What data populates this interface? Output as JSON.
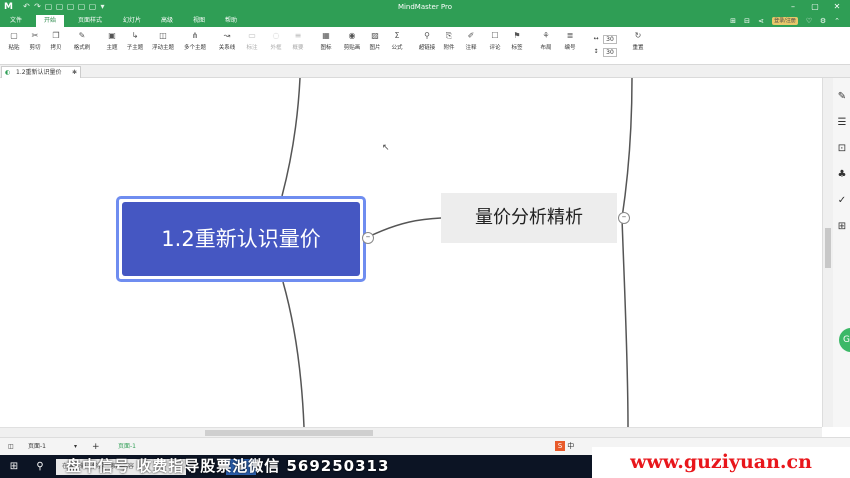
{
  "titlebar": {
    "title": "MindMaster Pro",
    "logo": "M",
    "quick_access": [
      "↶",
      "↷",
      "▢",
      "▢",
      "▢",
      "▢",
      "▢",
      "▾"
    ],
    "window_buttons": [
      "–",
      "▢",
      "✕"
    ]
  },
  "menubar": {
    "tabs": [
      "文件",
      "开始",
      "页面样式",
      "幻灯片",
      "高级",
      "视图",
      "帮助"
    ],
    "active_tab": "开始",
    "user": "登录/注册"
  },
  "ribbon": {
    "tools": [
      {
        "icon": "▢",
        "label": "粘贴"
      },
      {
        "icon": "✂",
        "label": "剪切"
      },
      {
        "icon": "❐",
        "label": "拷贝"
      },
      {
        "icon": "✎",
        "label": "格式刷"
      },
      {
        "icon": "▣",
        "label": "主题"
      },
      {
        "icon": "↳",
        "label": "子主题"
      },
      {
        "icon": "◫",
        "label": "浮动主题"
      },
      {
        "icon": "⋔",
        "label": "多个主题"
      },
      {
        "icon": "↝",
        "label": "关系线"
      },
      {
        "icon": "▭",
        "label": "标注"
      },
      {
        "icon": "◌",
        "label": "外框"
      },
      {
        "icon": "≡",
        "label": "概要"
      },
      {
        "icon": "▦",
        "label": "图标"
      },
      {
        "icon": "◉",
        "label": "剪贴画"
      },
      {
        "icon": "▨",
        "label": "图片"
      },
      {
        "icon": "Σ",
        "label": "公式"
      },
      {
        "icon": "⚲",
        "label": "超链接"
      },
      {
        "icon": "⎘",
        "label": "附件"
      },
      {
        "icon": "✐",
        "label": "注释"
      },
      {
        "icon": "☐",
        "label": "评论"
      },
      {
        "icon": "⚑",
        "label": "标签"
      },
      {
        "icon": "⚘",
        "label": "布局"
      },
      {
        "icon": "≣",
        "label": "编号"
      },
      {
        "icon": "↻",
        "label": "重置"
      }
    ],
    "size_w": "30",
    "size_h": "30"
  },
  "doc_tab": {
    "label": "1.2重新认识量价",
    "close": "✱"
  },
  "canvas": {
    "main_topic": "1.2重新认识量价",
    "sub_topic": "量价分析精析",
    "collapse_symbol": "–",
    "cursor": "↖"
  },
  "right_panel": {
    "icons": [
      "✎",
      "☰",
      "⊡",
      "♣",
      "✓",
      "⊞"
    ],
    "bubble": "G"
  },
  "pagebar": {
    "page_selector": "页面-1",
    "add": "+",
    "active_page": "页面-1",
    "ime": "中"
  },
  "taskbar": {
    "start": "⊞",
    "search_icon": "⚲",
    "search_text": "在这里输入你要搜索的内容"
  },
  "watermarks": {
    "left": "盘中信号 收费指导股票池微信 569250313",
    "right": "www.guziyuan.cn"
  }
}
